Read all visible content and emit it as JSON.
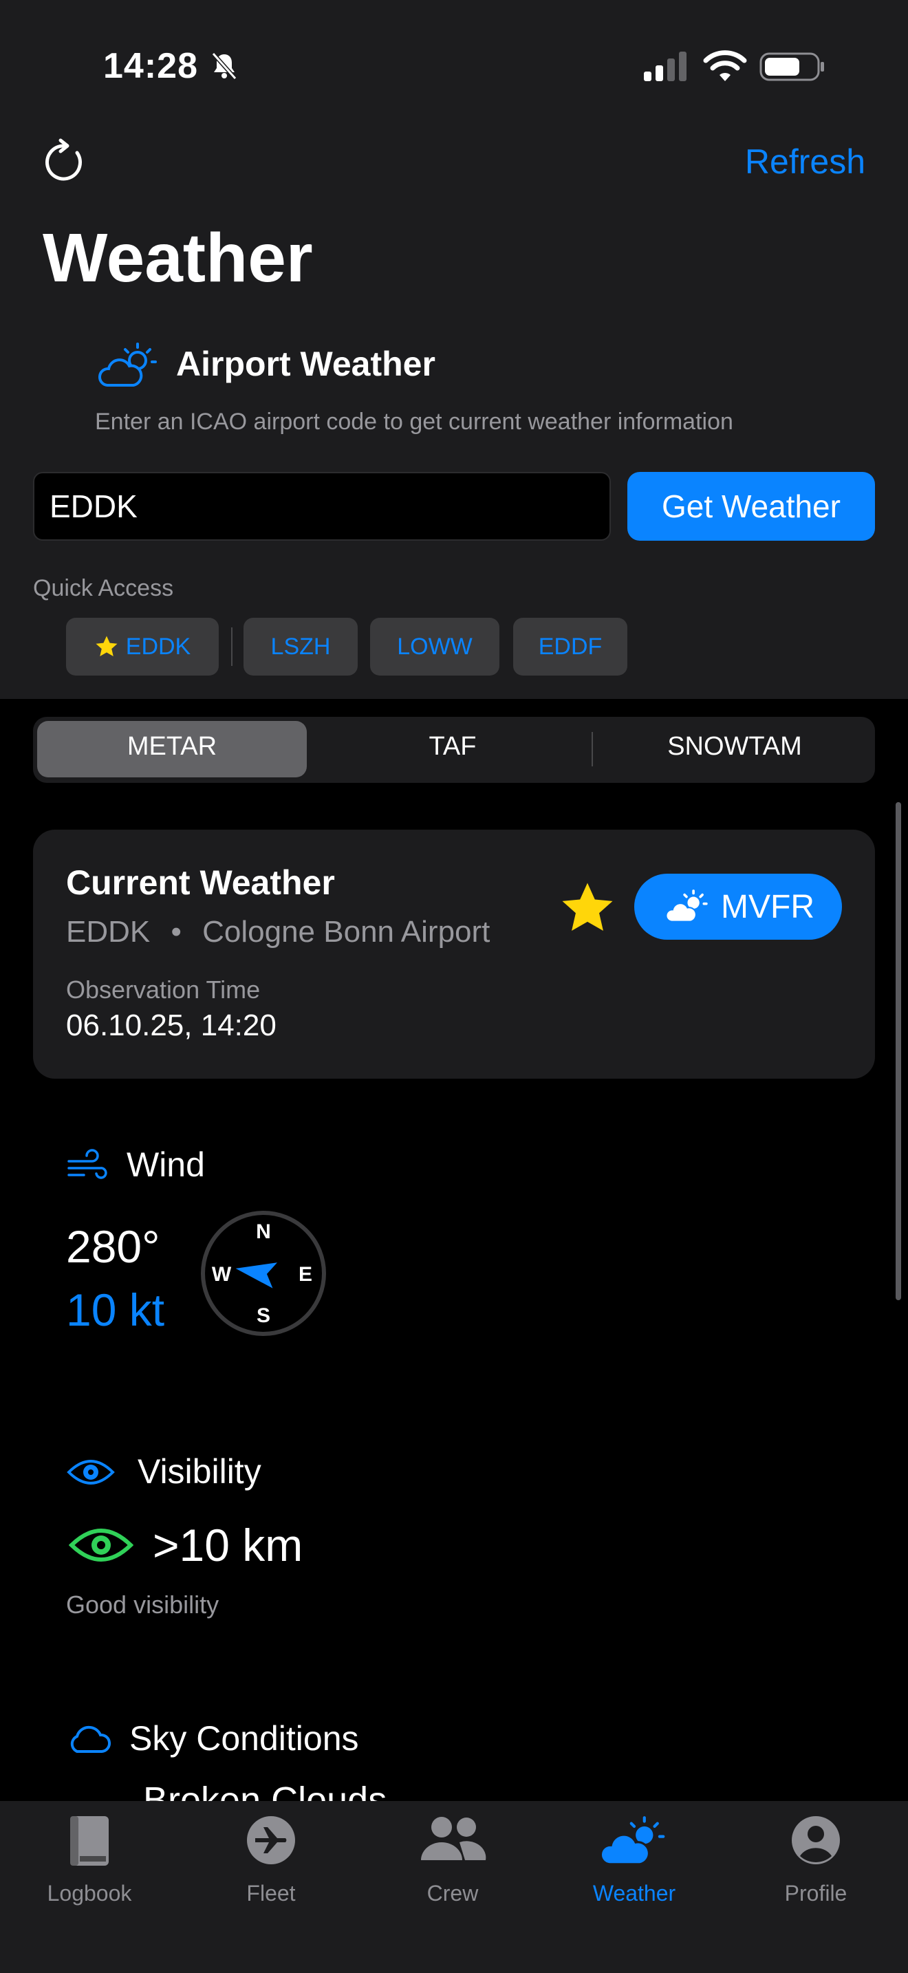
{
  "status_bar": {
    "time": "14:28"
  },
  "nav": {
    "refresh_label": "Refresh",
    "title": "Weather"
  },
  "airport_weather": {
    "title": "Airport Weather",
    "subtitle": "Enter an ICAO airport code to get current weather information",
    "input_value": "EDDK",
    "button_label": "Get Weather"
  },
  "quick_access": {
    "label": "Quick Access",
    "chips": [
      {
        "code": "EDDK",
        "favorite": true
      },
      {
        "code": "LSZH",
        "favorite": false
      },
      {
        "code": "LOWW",
        "favorite": false
      },
      {
        "code": "EDDF",
        "favorite": false
      }
    ]
  },
  "segments": {
    "items": [
      "METAR",
      "TAF",
      "SNOWTAM"
    ],
    "selected": "METAR"
  },
  "current_weather": {
    "title": "Current Weather",
    "station_code": "EDDK",
    "separator": "•",
    "airport_name": "Cologne Bonn Airport",
    "observation_label": "Observation Time",
    "observation_time": "06.10.25, 14:20",
    "flight_category": "MVFR",
    "is_favorite": true
  },
  "wind": {
    "title": "Wind",
    "direction": "280°",
    "speed": "10 kt",
    "compass": {
      "n": "N",
      "e": "E",
      "s": "S",
      "w": "W",
      "arrow_direction_deg": 280
    }
  },
  "visibility": {
    "title": "Visibility",
    "value": ">10 km",
    "description": "Good visibility"
  },
  "sky": {
    "title": "Sky Conditions",
    "first_layer_partial": "Broken Clouds"
  },
  "tab_bar": {
    "items": [
      {
        "label": "Logbook",
        "icon": "book-icon"
      },
      {
        "label": "Fleet",
        "icon": "airplane-icon"
      },
      {
        "label": "Crew",
        "icon": "people-icon"
      },
      {
        "label": "Weather",
        "icon": "cloud-sun-icon"
      },
      {
        "label": "Profile",
        "icon": "person-circle-icon"
      }
    ],
    "selected": "Weather"
  },
  "colors": {
    "accent": "#0a84ff",
    "background": "#000000",
    "surface": "#1c1c1e",
    "secondary_text": "#98989d",
    "star": "#ffd60a",
    "visibility_good": "#30d158"
  }
}
